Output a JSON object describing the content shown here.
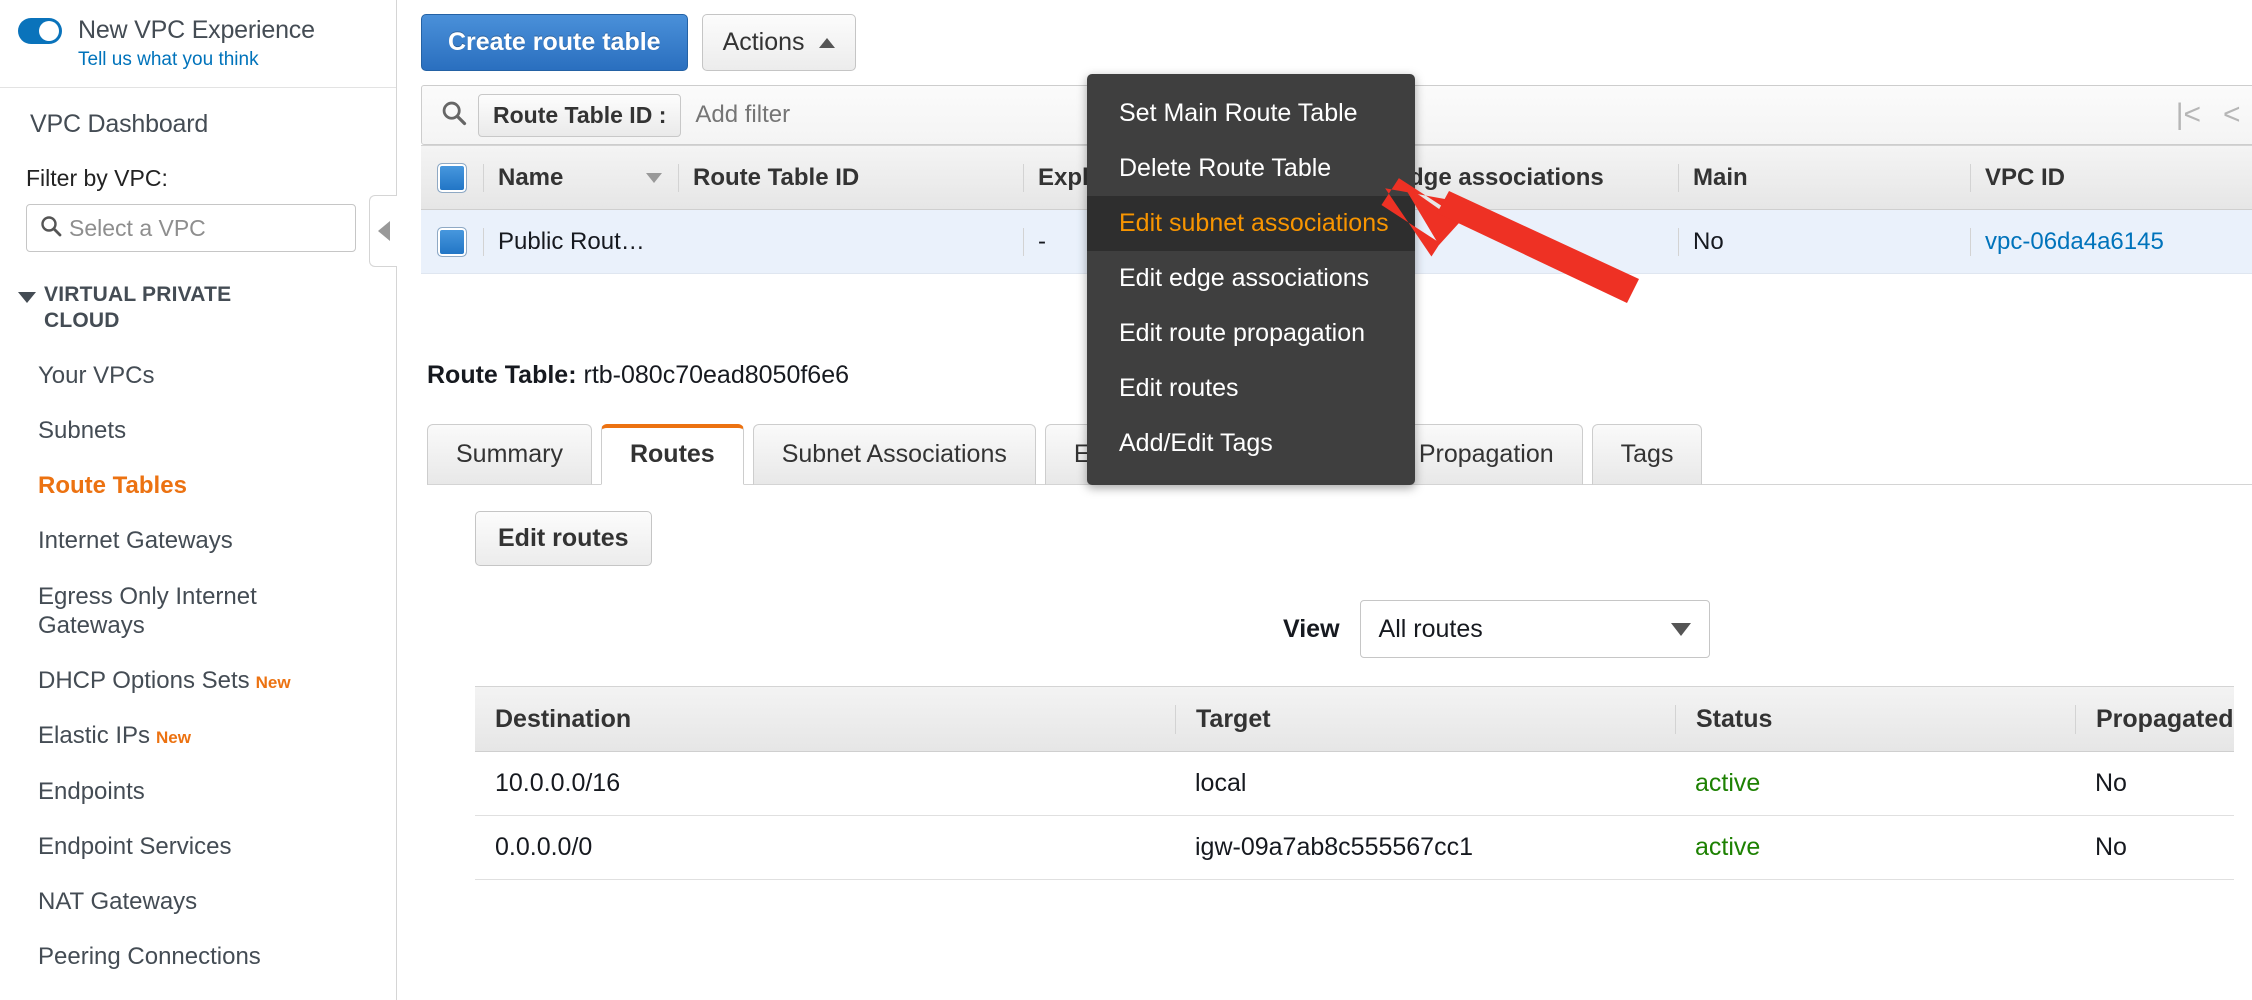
{
  "sidebar": {
    "new_experience_label": "New VPC Experience",
    "feedback_link": "Tell us what you think",
    "dashboard_label": "VPC Dashboard",
    "filter_label": "Filter by VPC:",
    "vpc_select_placeholder": "Select a VPC",
    "group_title": "VIRTUAL PRIVATE CLOUD",
    "items": [
      {
        "label": "Your VPCs",
        "active": false,
        "badge": ""
      },
      {
        "label": "Subnets",
        "active": false,
        "badge": ""
      },
      {
        "label": "Route Tables",
        "active": true,
        "badge": ""
      },
      {
        "label": "Internet Gateways",
        "active": false,
        "badge": ""
      },
      {
        "label": "Egress Only Internet Gateways",
        "active": false,
        "badge": ""
      },
      {
        "label": "DHCP Options Sets",
        "active": false,
        "badge": "New"
      },
      {
        "label": "Elastic IPs",
        "active": false,
        "badge": "New"
      },
      {
        "label": "Endpoints",
        "active": false,
        "badge": ""
      },
      {
        "label": "Endpoint Services",
        "active": false,
        "badge": ""
      },
      {
        "label": "NAT Gateways",
        "active": false,
        "badge": ""
      },
      {
        "label": "Peering Connections",
        "active": false,
        "badge": ""
      }
    ]
  },
  "toolbar": {
    "create_label": "Create route table",
    "actions_label": "Actions"
  },
  "actions_menu": {
    "items": [
      {
        "label": "Set Main Route Table",
        "highlighted": false
      },
      {
        "label": "Delete Route Table",
        "highlighted": false
      },
      {
        "label": "Edit subnet associations",
        "highlighted": true
      },
      {
        "label": "Edit edge associations",
        "highlighted": false
      },
      {
        "label": "Edit route propagation",
        "highlighted": false
      },
      {
        "label": "Edit routes",
        "highlighted": false
      },
      {
        "label": "Add/Edit Tags",
        "highlighted": false
      }
    ]
  },
  "search": {
    "token": "Route Table ID :",
    "placeholder": "Add filter",
    "pager_first": "|<",
    "pager_prev": "<"
  },
  "route_table_list": {
    "columns": [
      "Name",
      "Route Table ID",
      "Explicit subnet association",
      "Edge associations",
      "Main",
      "VPC ID"
    ],
    "rows": [
      {
        "name": "Public Rout…",
        "route_table_id": "",
        "explicit_subnet_association": "-",
        "edge_associations": "-",
        "main": "No",
        "vpc_id": "vpc-06da4a6145"
      }
    ]
  },
  "detail": {
    "title_label": "Route Table:",
    "route_table_id": "rtb-080c70ead8050f6e6",
    "tabs": [
      {
        "label": "Summary",
        "active": false
      },
      {
        "label": "Routes",
        "active": true
      },
      {
        "label": "Subnet Associations",
        "active": false
      },
      {
        "label": "Edge Associations",
        "active": false
      },
      {
        "label": "Route Propagation",
        "active": false
      },
      {
        "label": "Tags",
        "active": false
      }
    ],
    "edit_routes_label": "Edit routes",
    "view_label": "View",
    "view_value": "All routes",
    "routes_table": {
      "columns": [
        "Destination",
        "Target",
        "Status",
        "Propagated"
      ],
      "rows": [
        {
          "destination": "10.0.0.0/16",
          "target": "local",
          "target_is_link": false,
          "status": "active",
          "propagated": "No"
        },
        {
          "destination": "0.0.0.0/0",
          "target": "igw-09a7ab8c555567cc1",
          "target_is_link": true,
          "status": "active",
          "propagated": "No"
        }
      ]
    }
  },
  "colors": {
    "accent_orange": "#ec7211",
    "link_blue": "#0073bb",
    "primary_blue": "#2a6fbf",
    "status_green": "#1d8102",
    "annotation_red": "#ee3124"
  }
}
